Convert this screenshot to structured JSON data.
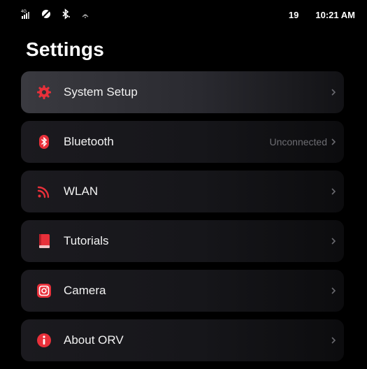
{
  "status_bar": {
    "network_label": "4G",
    "battery": "19",
    "time": "10:21 AM"
  },
  "page": {
    "title": "Settings"
  },
  "colors": {
    "accent": "#e8303a",
    "background": "#000000"
  },
  "settings": [
    {
      "label": "System Setup",
      "value": "",
      "icon": "gear-icon",
      "active": true
    },
    {
      "label": "Bluetooth",
      "value": "Unconnected",
      "icon": "bluetooth-icon",
      "active": false
    },
    {
      "label": "WLAN",
      "value": "",
      "icon": "wifi-icon",
      "active": false
    },
    {
      "label": "Tutorials",
      "value": "",
      "icon": "book-icon",
      "active": false
    },
    {
      "label": "Camera",
      "value": "",
      "icon": "camera-icon",
      "active": false
    },
    {
      "label": "About ORV",
      "value": "",
      "icon": "info-icon",
      "active": false
    }
  ]
}
